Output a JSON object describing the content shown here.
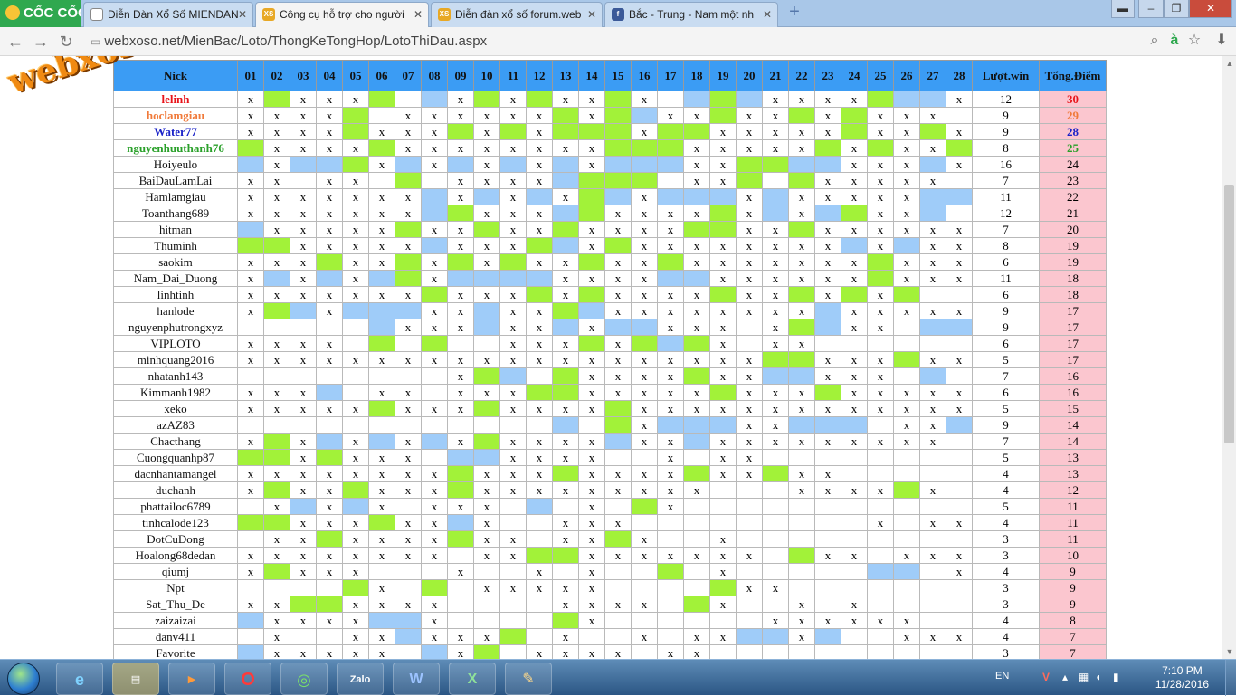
{
  "browser": {
    "brand": "CỐC CỐC",
    "tabs": [
      {
        "title": "Diễn Đàn Xổ Số MIENDAN",
        "icon": "page-icon",
        "active": false
      },
      {
        "title": "Công cụ hỗ trợ cho người",
        "icon": "xs-icon",
        "active": true
      },
      {
        "title": "Diễn đàn xổ số forum.web",
        "icon": "xs-icon",
        "active": false
      },
      {
        "title": "Bắc - Trung - Nam một nh",
        "icon": "facebook-icon",
        "active": false
      }
    ],
    "url_prefix": "webxoso.net",
    "url_path": "/MienBac/Loto/ThongKeTongHop/LotoThiDau.aspx",
    "watermark": "webxoso.net"
  },
  "table": {
    "headers": {
      "nick": "Nick",
      "cols": [
        "01",
        "02",
        "03",
        "04",
        "05",
        "06",
        "07",
        "08",
        "09",
        "10",
        "11",
        "12",
        "13",
        "14",
        "15",
        "16",
        "17",
        "18",
        "19",
        "20",
        "21",
        "22",
        "23",
        "24",
        "25",
        "26",
        "27",
        "28"
      ],
      "wins": "Lượt.win",
      "points": "Tổng.Điểm"
    },
    "legend_colors": {
      "g": "#a2f239",
      "b": "#9fccf9",
      "points_bg": "#fbc6cf",
      "header_bg": "#3b9cf4"
    },
    "rows": [
      {
        "nick": "lelinh",
        "color": "#e8141a",
        "wins": "12",
        "points": "30",
        "cells": "xgxxxg.bxgxgxxgx.bgbxxxxgbbx"
      },
      {
        "nick": "hoclamgiau",
        "color": "#f07a3a",
        "wins": "9",
        "points": "29",
        "cells": "xxxxg.xxxxxxgxgbxxgxxgxgxxx"
      },
      {
        "nick": "Water77",
        "color": "#1a22c8",
        "wins": "9",
        "points": "28",
        "cells": "xxxxgxxxgxgxgggxggxxxxxgxxgx"
      },
      {
        "nick": "nguyenhuuthanh76",
        "color": "#2aa02a",
        "wins": "8",
        "points": "25",
        "cells": "gxxxxgxxxxxxxxgggxxxxxgxgxxgx"
      },
      {
        "nick": "Hoiyeulo",
        "color": "#111",
        "wins": "16",
        "points": "24",
        "cells": "bxbbgxbxbxbxbxbbbxxggbbxxxbx"
      },
      {
        "nick": "BaiDauLamLai",
        "color": "#111",
        "wins": "7",
        "points": "23",
        "cells": "xx.xx.g.xxxxbggg.xxg.gxxxxx.."
      },
      {
        "nick": "Hamlamgiau",
        "color": "#111",
        "wins": "11",
        "points": "22",
        "cells": "xxxxxxxbxbxbxgbxbbbxbxxxxxbb"
      },
      {
        "nick": "Toanthang689",
        "color": "#111",
        "wins": "12",
        "points": "21",
        "cells": "xxxxxxxbgxxxbgxxxxgxbxbgxxb."
      },
      {
        "nick": "hitman",
        "color": "#111",
        "wins": "7",
        "points": "20",
        "cells": "bxxxxxgxxgxxgxxxxggxxgxxxxxx"
      },
      {
        "nick": "Thuminh",
        "color": "#111",
        "wins": "8",
        "points": "19",
        "cells": "ggxxxxxbxxxgbxgxxxxxxxxbxbxx"
      },
      {
        "nick": "saokim",
        "color": "#111",
        "wins": "6",
        "points": "19",
        "cells": "xxxgxxgxgxgxxgxxgxxxxxxxgxxx"
      },
      {
        "nick": "Nam_Dai_Duong",
        "color": "#111",
        "wins": "11",
        "points": "18",
        "cells": "xbxbxbgxbbbbxxxxbbxxxxxxgxxx"
      },
      {
        "nick": "linhtinh",
        "color": "#111",
        "wins": "6",
        "points": "18",
        "cells": "xxxxxxxgxxxgxgxxxxgxxgxgxg"
      },
      {
        "nick": "hanlode",
        "color": "#111",
        "wins": "9",
        "points": "17",
        "cells": "xgbxbbbxxbxxgbxxxxxxxxbxxxxx"
      },
      {
        "nick": "nguyenphutrongxyz",
        "color": "#111",
        "wins": "9",
        "points": "17",
        "cells": ".....bxxxbxxbxbbxxx.xgbxx.bb"
      },
      {
        "nick": "VIPLOTO",
        "color": "#111",
        "wins": "6",
        "points": "17",
        "cells": "xxxx.g.g..xxxgxgbgx.xx......"
      },
      {
        "nick": "minhquang2016",
        "color": "#111",
        "wins": "5",
        "points": "17",
        "cells": "xxxxxxxxxxxxxxxxxxxxggxxxgxx"
      },
      {
        "nick": "nhatanh143",
        "color": "#111",
        "wins": "7",
        "points": "16",
        "cells": "........xgb.gxxxxgxxbbxxx.b."
      },
      {
        "nick": "Kimmanh1982",
        "color": "#111",
        "wins": "6",
        "points": "16",
        "cells": "xxxb.xx.xxxggxxxxxgxxxgxxxxx"
      },
      {
        "nick": "xeko",
        "color": "#111",
        "wins": "5",
        "points": "15",
        "cells": "xxxxxgxxxgxxxxgxxxxxxxxxxxxx"
      },
      {
        "nick": "azAZ83",
        "color": "#111",
        "wins": "9",
        "points": "14",
        "cells": "............b.gxbbbxxbbb.xxb"
      },
      {
        "nick": "Chacthang",
        "color": "#111",
        "wins": "7",
        "points": "14",
        "cells": "xgxbxbxbxgxxxxbxxbxxxxxxxxx."
      },
      {
        "nick": "Cuongquanhp87",
        "color": "#111",
        "wins": "5",
        "points": "13",
        "cells": "ggxgxxx.bbxxxx..x.xx........"
      },
      {
        "nick": "dacnhantamangel",
        "color": "#111",
        "wins": "4",
        "points": "13",
        "cells": "xxxxxxxxgxxxgxxxxgxxgxx....."
      },
      {
        "nick": "duchanh",
        "color": "#111",
        "wins": "4",
        "points": "12",
        "cells": "xgxxgxxxgxxxxxxxxx...xxxxgx."
      },
      {
        "nick": "phattailoc6789",
        "color": "#111",
        "wins": "5",
        "points": "11",
        "cells": ".xbxbx.xxx.b.x.gx..........."
      },
      {
        "nick": "tinhcalode123",
        "color": "#111",
        "wins": "4",
        "points": "11",
        "cells": "ggxxxgxxbx..xxx.........x.xx"
      },
      {
        "nick": "DotCuDong",
        "color": "#111",
        "wins": "3",
        "points": "11",
        "cells": ".xxgxxxxgxx.xxgx..x........."
      },
      {
        "nick": "Hoalong68dedan",
        "color": "#111",
        "wins": "3",
        "points": "10",
        "cells": "xxxxxxxx.xxggxxxxxxx.gxx.xxx"
      },
      {
        "nick": "qiumj",
        "color": "#111",
        "wins": "4",
        "points": "9",
        "cells": "xgxxx...x..x.x..g.x.....bb.x"
      },
      {
        "nick": "Npt",
        "color": "#111",
        "wins": "3",
        "points": "9",
        "cells": "....gx.g.xxxxx....gxx........"
      },
      {
        "nick": "Sat_Thu_De",
        "color": "#111",
        "wins": "3",
        "points": "9",
        "cells": "xxggxxxx....xxxx.gx..x.x...."
      },
      {
        "nick": "zaizaizai",
        "color": "#111",
        "wins": "4",
        "points": "8",
        "cells": "bxxxxbbx....gx......xxxxxx.."
      },
      {
        "nick": "danv411",
        "color": "#111",
        "wins": "4",
        "points": "7",
        "cells": ".x..xxbxxxg.x..x.xxbbxb..xxx"
      },
      {
        "nick": "Favorite",
        "color": "#111",
        "wins": "3",
        "points": "7",
        "cells": "bxxxxx.bxg.xxxx.xx.........."
      }
    ]
  },
  "taskbar": {
    "apps": [
      "ie-icon",
      "explorer-icon",
      "media-icon",
      "opera-icon",
      "coccoc-icon",
      "zalo-icon",
      "word-icon",
      "excel-icon",
      "paint-icon"
    ],
    "zalo_label": "Zalo",
    "lang": "EN",
    "time": "7:10 PM",
    "date": "11/28/2016"
  }
}
